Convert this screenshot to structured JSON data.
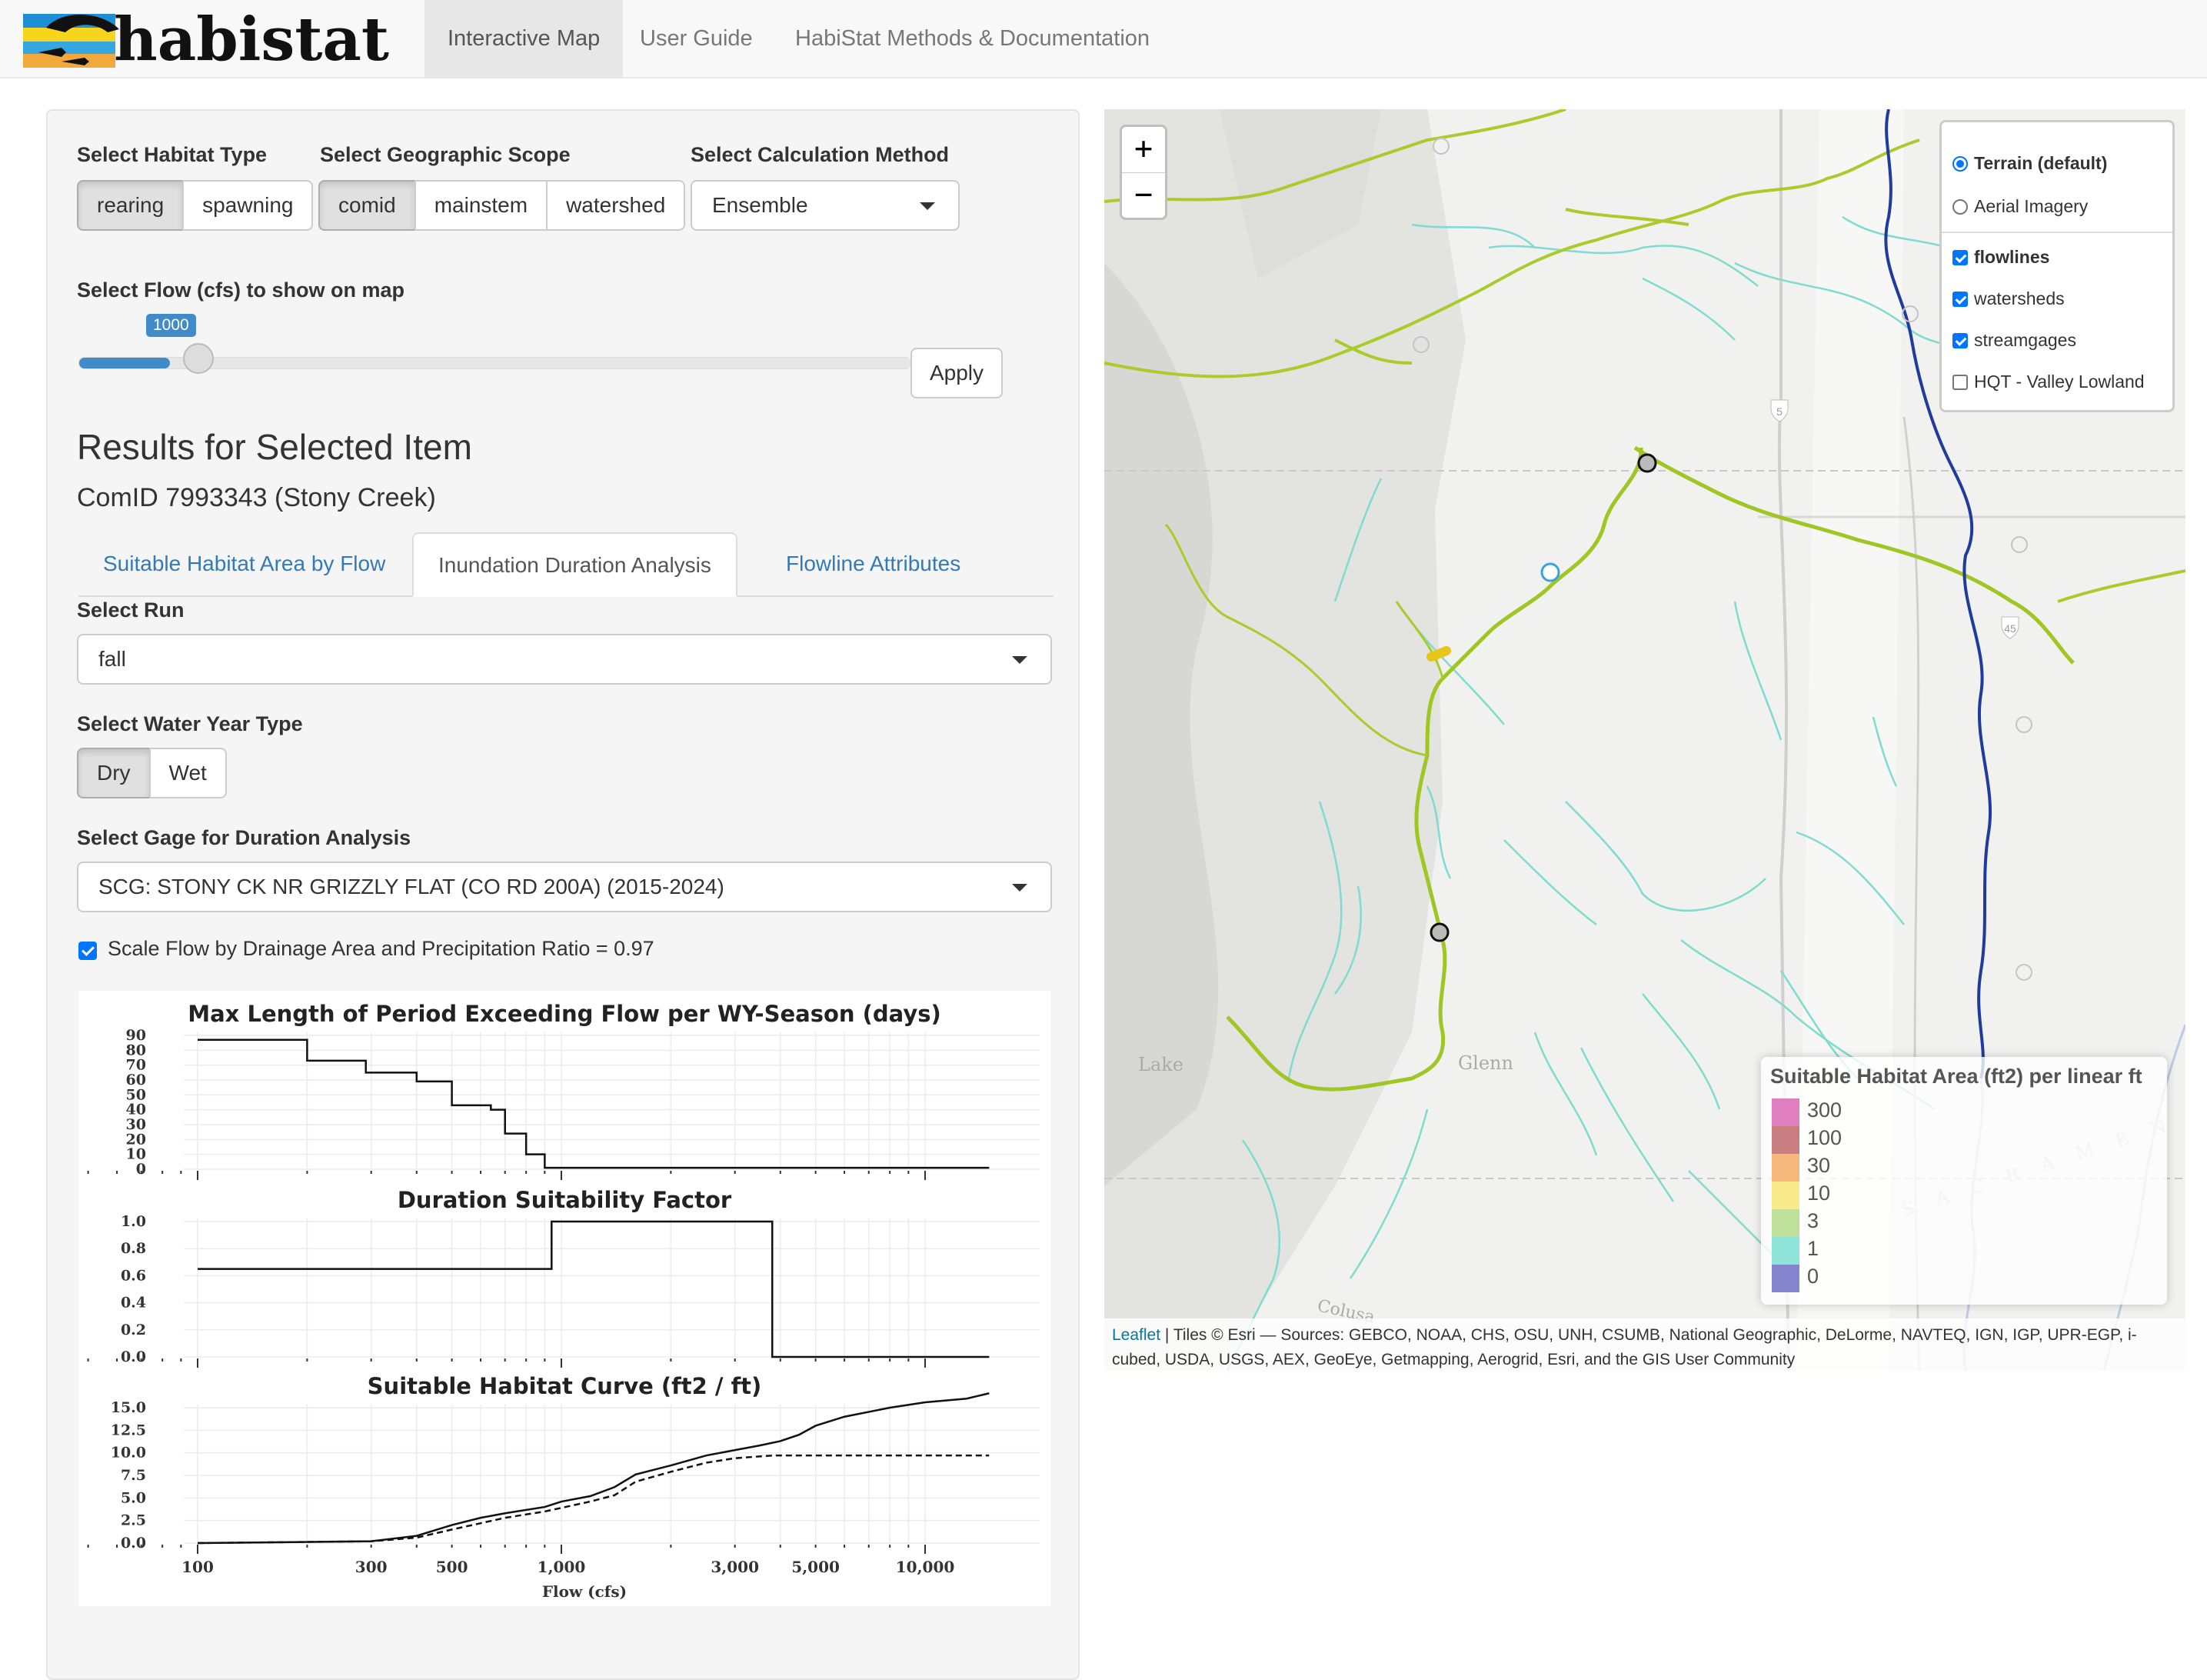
{
  "nav": {
    "logo_text": "habistat",
    "tabs": [
      {
        "label": "Interactive Map",
        "active": true
      },
      {
        "label": "User Guide",
        "active": false
      },
      {
        "label": "HabiStat Methods & Documentation",
        "active": false
      }
    ]
  },
  "controls": {
    "habitat_type": {
      "label": "Select Habitat Type",
      "options": [
        "rearing",
        "spawning"
      ],
      "selected": "rearing"
    },
    "geographic_scope": {
      "label": "Select Geographic Scope",
      "options": [
        "comid",
        "mainstem",
        "watershed"
      ],
      "selected": "comid"
    },
    "calculation_method": {
      "label": "Select Calculation Method",
      "value": "Ensemble"
    },
    "flow": {
      "label": "Select Flow (cfs) to show on map",
      "value": "1000",
      "apply_label": "Apply"
    }
  },
  "results": {
    "title": "Results for Selected Item",
    "subtitle": "ComID 7993343 (Stony Creek)",
    "tabs": [
      {
        "label": "Suitable Habitat Area by Flow",
        "active": false
      },
      {
        "label": "Inundation Duration Analysis",
        "active": true
      },
      {
        "label": "Flowline Attributes",
        "active": false
      }
    ],
    "run": {
      "label": "Select Run",
      "value": "fall"
    },
    "water_year_type": {
      "label": "Select Water Year Type",
      "options": [
        "Dry",
        "Wet"
      ],
      "selected": "Dry"
    },
    "gage": {
      "label": "Select Gage for Duration Analysis",
      "value": "SCG: STONY CK NR GRIZZLY FLAT (CO RD 200A) (2015-2024)"
    },
    "scale_checkbox": {
      "label": "Scale Flow by Drainage Area and Precipitation Ratio = 0.97",
      "checked": true
    }
  },
  "chart_data": [
    {
      "type": "line",
      "title": "Max Length of Period Exceeding Flow per WY-Season (days)",
      "x_scale": "log",
      "xlim": [
        100,
        15000
      ],
      "ylim": [
        0,
        90
      ],
      "y_ticks": [
        "90",
        "80",
        "70",
        "60",
        "50",
        "40",
        "30",
        "20",
        "10",
        "0"
      ],
      "series": [
        {
          "x": [
            100,
            200,
            200,
            290,
            290,
            400,
            400,
            500,
            500,
            640,
            640,
            700,
            700,
            800,
            800,
            900,
            900,
            15000
          ],
          "y": [
            87,
            87,
            73,
            73,
            65,
            65,
            59,
            59,
            43,
            43,
            40,
            40,
            24,
            24,
            10,
            10,
            1,
            1
          ]
        }
      ]
    },
    {
      "type": "line",
      "title": "Duration Suitability Factor",
      "x_scale": "log",
      "xlim": [
        100,
        15000
      ],
      "ylim": [
        0,
        1.0
      ],
      "y_ticks": [
        "1.0",
        "0.8",
        "0.6",
        "0.4",
        "0.2",
        "0.0"
      ],
      "series": [
        {
          "x": [
            100,
            940,
            940,
            3800,
            3800,
            15000
          ],
          "y": [
            0.65,
            0.65,
            1.0,
            1.0,
            0.0,
            0.0
          ]
        }
      ]
    },
    {
      "type": "line",
      "title": "Suitable Habitat Curve (ft2 / ft)",
      "x_scale": "log",
      "xlim": [
        100,
        15000
      ],
      "ylim": [
        0,
        15
      ],
      "xlabel": "Flow (cfs)",
      "x_ticks": [
        "100",
        "300",
        "500",
        "1,000",
        "3,000",
        "5,000",
        "10,000"
      ],
      "y_ticks": [
        "15.0",
        "12.5",
        "10.0",
        "7.5",
        "5.0",
        "2.5",
        "0.0"
      ],
      "series": [
        {
          "style": "solid",
          "x": [
            100,
            300,
            400,
            500,
            600,
            700,
            900,
            1000,
            1200,
            1400,
            1600,
            2000,
            2500,
            3000,
            3500,
            4000,
            4500,
            5000,
            6000,
            8000,
            10000,
            13000,
            15000
          ],
          "y": [
            0,
            0.2,
            0.8,
            2.0,
            2.8,
            3.3,
            4.0,
            4.6,
            5.2,
            6.2,
            7.6,
            8.6,
            9.7,
            10.3,
            10.8,
            11.3,
            12.0,
            13.0,
            14.0,
            15.0,
            15.6,
            16.0,
            16.6
          ]
        },
        {
          "style": "dashed",
          "x": [
            100,
            300,
            400,
            500,
            600,
            700,
            900,
            1000,
            1200,
            1400,
            1600,
            2000,
            2500,
            3000,
            3500,
            3800,
            15000
          ],
          "y": [
            0,
            0.2,
            0.6,
            1.5,
            2.2,
            2.8,
            3.5,
            3.9,
            4.6,
            5.3,
            6.8,
            7.9,
            8.9,
            9.4,
            9.6,
            9.7,
            9.7
          ]
        }
      ]
    }
  ],
  "map": {
    "zoom_in": "+",
    "zoom_out": "−",
    "base_layers": [
      {
        "label": "Terrain (default)",
        "selected": true
      },
      {
        "label": "Aerial Imagery",
        "selected": false
      }
    ],
    "overlays": [
      {
        "label": "flowlines",
        "checked": true
      },
      {
        "label": "watersheds",
        "checked": true
      },
      {
        "label": "streamgages",
        "checked": true
      },
      {
        "label": "HQT - Valley Lowland",
        "checked": false
      }
    ],
    "place_labels": [
      "Lake",
      "Glenn",
      "Colusa",
      "SACRAMENTO VALLEY",
      "5",
      "45"
    ],
    "legend": {
      "title": "Suitable Habitat Area (ft2) per linear ft",
      "items": [
        {
          "label": "300",
          "color": "#e07fbf"
        },
        {
          "label": "100",
          "color": "#c97f82"
        },
        {
          "label": "30",
          "color": "#f5b87a"
        },
        {
          "label": "10",
          "color": "#f9ea8c"
        },
        {
          "label": "3",
          "color": "#bfe09a"
        },
        {
          "label": "1",
          "color": "#8fe4da"
        },
        {
          "label": "0",
          "color": "#8484cf"
        }
      ]
    },
    "attribution": {
      "leaflet": "Leaflet",
      "text": "| Tiles © Esri — Sources: GEBCO, NOAA, CHS, OSU, UNH, CSUMB, National Geographic, DeLorme, NAVTEQ, IGN, IGP, UPR-EGP, i-cubed, USDA, USGS, AEX, GeoEye, Getmapping, Aerogrid, Esri, and the GIS User Community"
    }
  },
  "colors": {
    "accent": "#428bca",
    "link": "#337ab7",
    "sacramento_river": "#1f3c9c",
    "stony_creek": "#9fc623"
  }
}
